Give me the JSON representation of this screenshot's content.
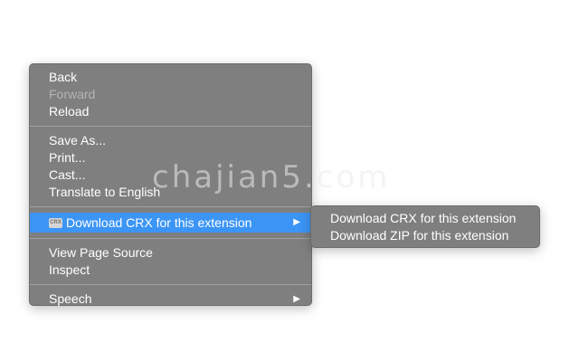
{
  "context_menu": {
    "items": [
      {
        "label": "Back",
        "enabled": true
      },
      {
        "label": "Forward",
        "enabled": false
      },
      {
        "label": "Reload",
        "enabled": true
      },
      {
        "label": "Save As...",
        "enabled": true
      },
      {
        "label": "Print...",
        "enabled": true
      },
      {
        "label": "Cast...",
        "enabled": true
      },
      {
        "label": "Translate to English",
        "enabled": true
      },
      {
        "label": "Download CRX for this extension",
        "icon_text": "CRX",
        "enabled": true,
        "highlighted": true,
        "has_submenu": true
      },
      {
        "label": "View Page Source",
        "enabled": true
      },
      {
        "label": "Inspect",
        "enabled": true
      },
      {
        "label": "Speech",
        "enabled": true,
        "has_submenu": true
      }
    ],
    "submenu_arrow": "▶"
  },
  "submenu": {
    "items": [
      {
        "label": "Download CRX for this extension"
      },
      {
        "label": "Download ZIP for this extension"
      }
    ]
  },
  "watermark": "chajian5.com",
  "colors": {
    "menu_background": "#7f7f7f",
    "highlight": "#3c95f5",
    "text": "#ffffff",
    "disabled_text": "#b4b4b4"
  }
}
